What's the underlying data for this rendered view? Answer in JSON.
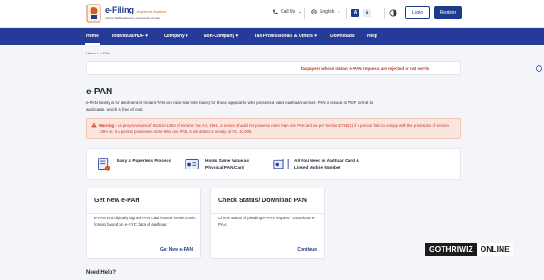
{
  "header": {
    "logo_title": "e-Filing",
    "logo_tagline": "Anywhere Anytime",
    "logo_sub": "Income Tax Department, Government of India",
    "call_us": "Call Us",
    "language": "English",
    "font_decrease": "A",
    "font_increase": "A",
    "login_label": "Login",
    "register_label": "Register"
  },
  "nav": {
    "items": [
      {
        "label": "Home"
      },
      {
        "label": "Individual/HUF"
      },
      {
        "label": "Company"
      },
      {
        "label": "Non-Company"
      },
      {
        "label": "Tax Professionals & Others"
      },
      {
        "label": "Downloads"
      },
      {
        "label": "Help"
      }
    ]
  },
  "breadcrumb": {
    "home": "Home",
    "sep": ">",
    "current": "e-PAN"
  },
  "notice": {
    "text": "Taxpayers whose instant e-PAN requests are rejected or not servic"
  },
  "page": {
    "title": "e-PAN",
    "description": "e-PAN facility is for allotment of Instant PAN (on near-real time basis) for those applicants who possess a valid Aadhaar number. PAN is issued in PDF format to applicants, which is free of cost."
  },
  "warning": {
    "label": "Warning :",
    "text": "As per provisions of Section 139A of Income Tax Act, 1961, a person should not possess more than one PAN and as per Section 272B(1) if a person fails to comply with the provisions of section 139A i.e. if a person possesses more than one PAN, it will attract a penalty of Rs. 10,000."
  },
  "features": [
    {
      "text": "Easy & Paperless Process",
      "icon": "paperless-icon"
    },
    {
      "text": "Holds Same Value as Physical PAN Card",
      "icon": "pan-card-icon"
    },
    {
      "text": "All You Need is Aadhaar Card & Linked Mobile Number",
      "icon": "aadhaar-icon"
    }
  ],
  "cards": [
    {
      "title": "Get New e-PAN",
      "body": "e-PAN is a digitally signed PAN card issued in electronic format based on e-KYC data of aadhaar.",
      "link": "Get New e-PAN"
    },
    {
      "title": "Check Status/ Download PAN",
      "body": "Check status of pending e-PAN request / Download e-PAN.",
      "link": "Continue"
    }
  ],
  "help": {
    "title": "Need Help?"
  },
  "watermark": {
    "left": "GOTHRIWIZ",
    "right": "ONLINE"
  },
  "colors": {
    "primary": "#243b97",
    "warning_bg": "#fbe6df",
    "warning_text": "#c0392b"
  }
}
